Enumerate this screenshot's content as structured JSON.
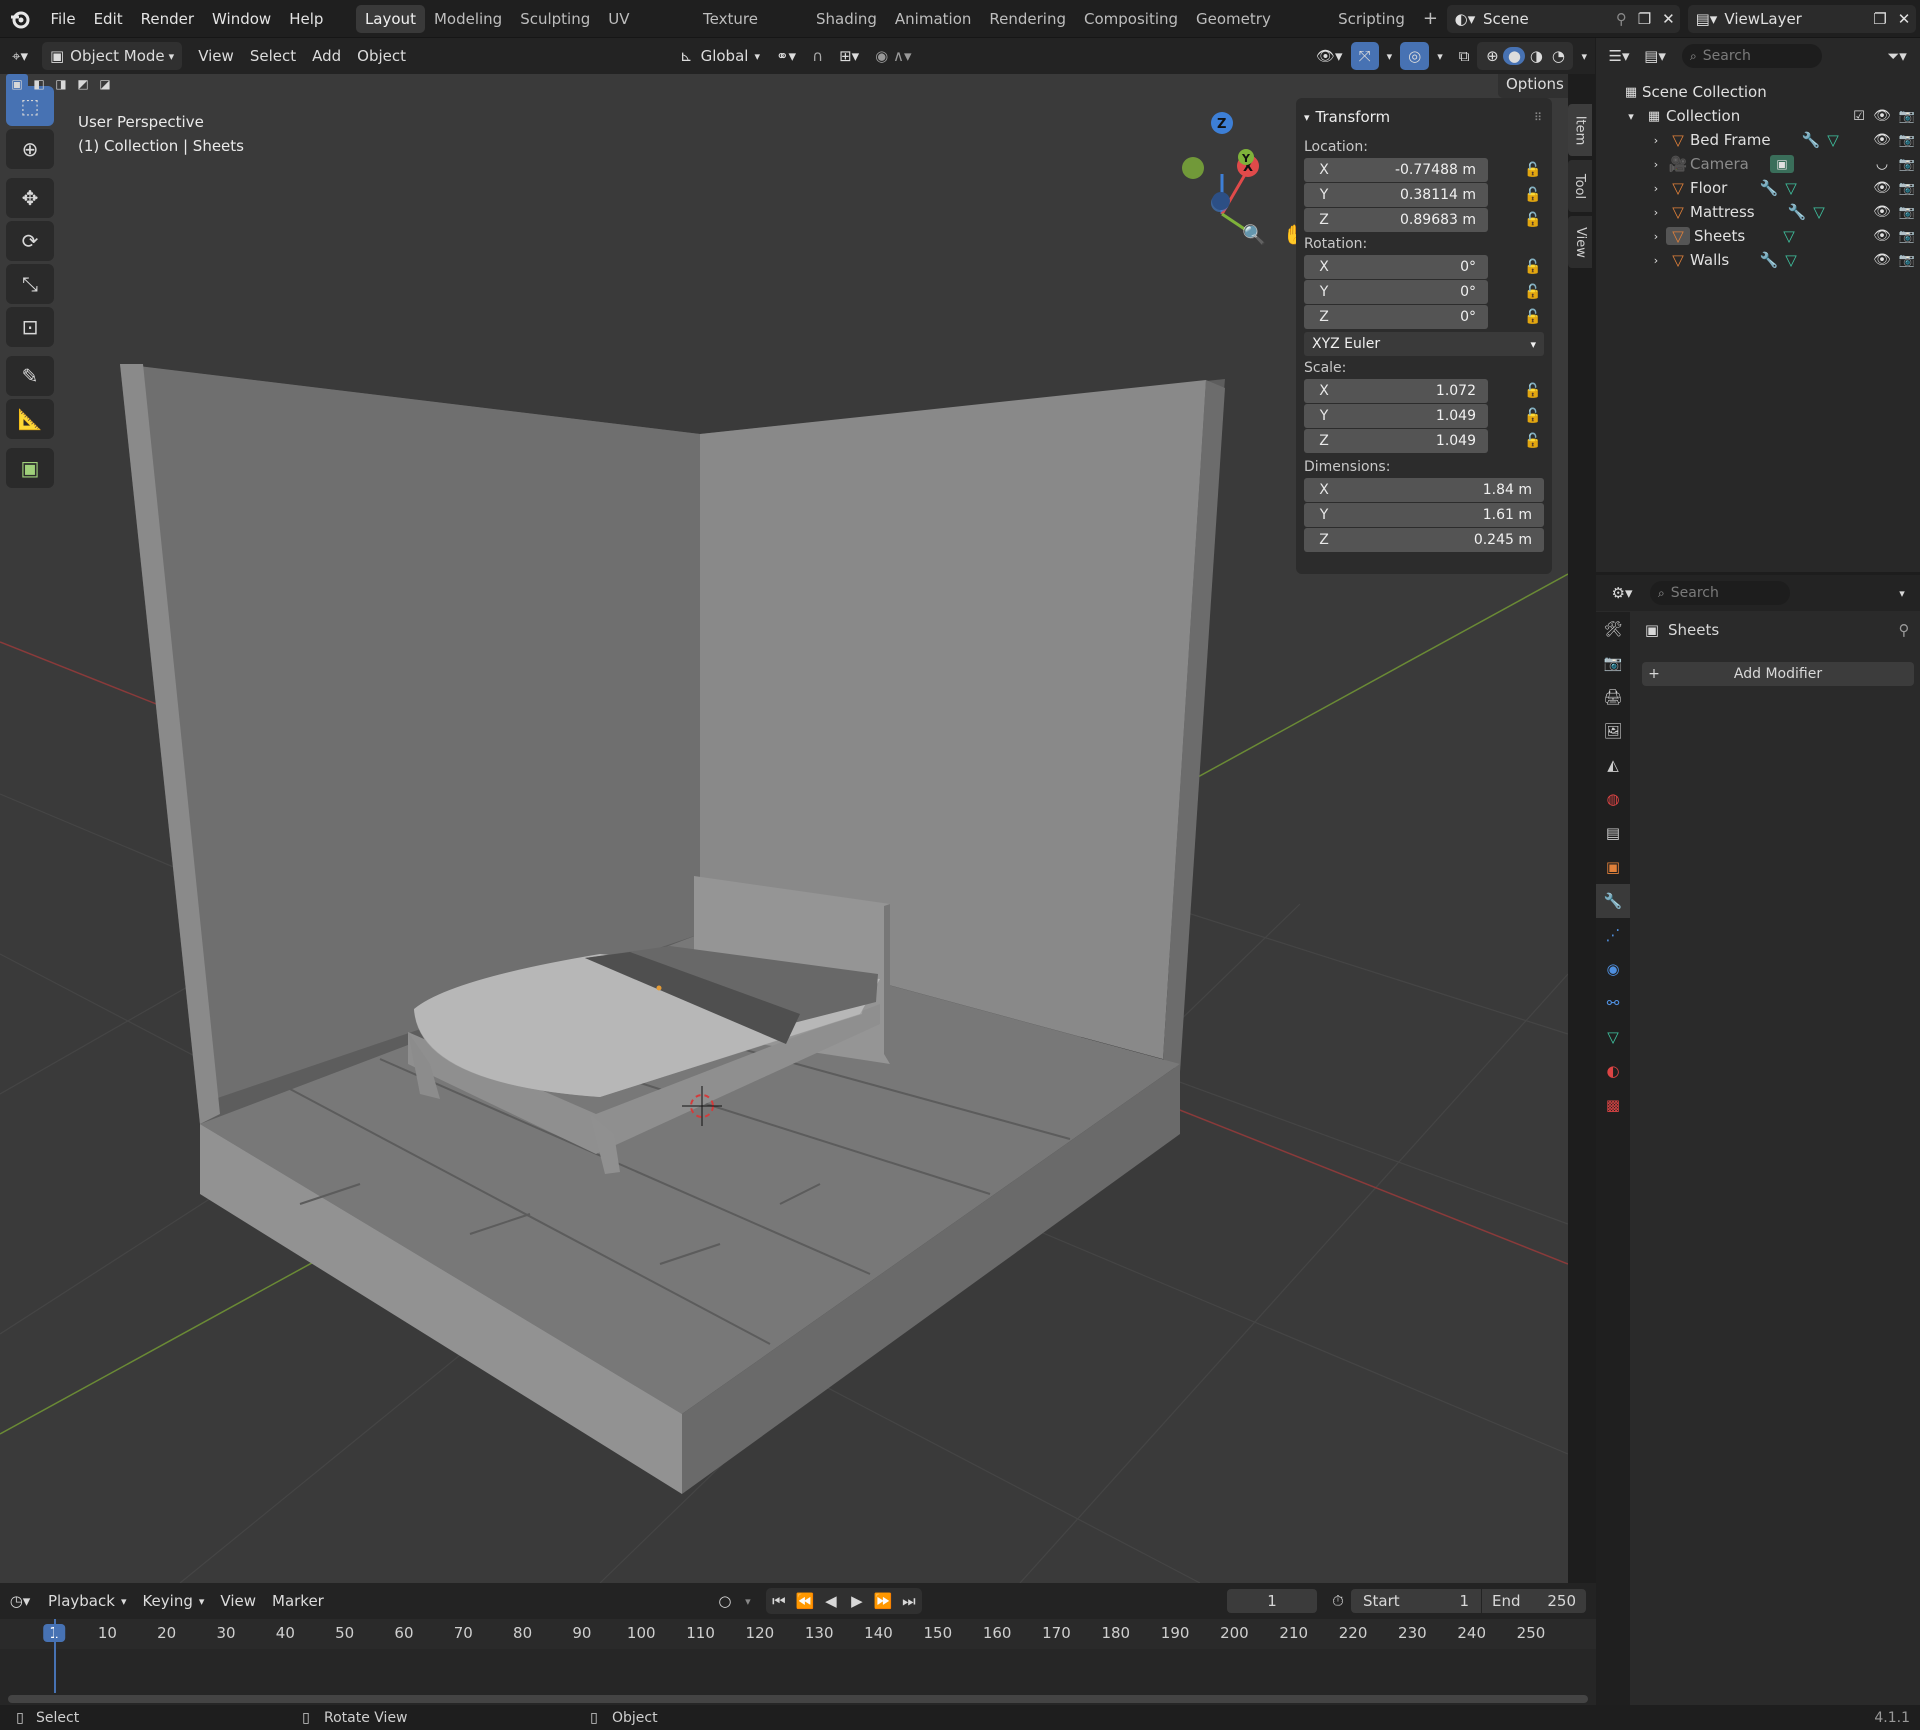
{
  "menu": {
    "file": "File",
    "edit": "Edit",
    "render": "Render",
    "window": "Window",
    "help": "Help"
  },
  "workspaces": [
    "Layout",
    "Modeling",
    "Sculpting",
    "UV Editing",
    "Texture Paint",
    "Shading",
    "Animation",
    "Rendering",
    "Compositing",
    "Geometry Nodes",
    "Scripting"
  ],
  "scene": {
    "name": "Scene",
    "view_layer": "ViewLayer"
  },
  "viewport_header": {
    "mode": "Object Mode",
    "view": "View",
    "select": "Select",
    "add": "Add",
    "object": "Object",
    "orientation": "Global",
    "options": "Options"
  },
  "viewport": {
    "perspective": "User Perspective",
    "context": "(1) Collection | Sheets"
  },
  "npanel": {
    "section": "Transform",
    "location_label": "Location:",
    "location": [
      {
        "axis": "X",
        "value": "-0.77488 m"
      },
      {
        "axis": "Y",
        "value": "0.38114 m"
      },
      {
        "axis": "Z",
        "value": "0.89683 m"
      }
    ],
    "rotation_label": "Rotation:",
    "rotation": [
      {
        "axis": "X",
        "value": "0°"
      },
      {
        "axis": "Y",
        "value": "0°"
      },
      {
        "axis": "Z",
        "value": "0°"
      }
    ],
    "rotation_mode": "XYZ Euler",
    "scale_label": "Scale:",
    "scale": [
      {
        "axis": "X",
        "value": "1.072"
      },
      {
        "axis": "Y",
        "value": "1.049"
      },
      {
        "axis": "Z",
        "value": "1.049"
      }
    ],
    "dimensions_label": "Dimensions:",
    "dimensions": [
      {
        "axis": "X",
        "value": "1.84 m"
      },
      {
        "axis": "Y",
        "value": "1.61 m"
      },
      {
        "axis": "Z",
        "value": "0.245 m"
      }
    ],
    "tabs": [
      "Item",
      "Tool",
      "View"
    ]
  },
  "outliner": {
    "search_placeholder": "Search",
    "root": "Scene Collection",
    "collection": "Collection",
    "items": [
      {
        "name": "Bed Frame",
        "type": "mesh",
        "modifier": true
      },
      {
        "name": "Camera",
        "type": "camera",
        "modifier": false
      },
      {
        "name": "Floor",
        "type": "mesh",
        "modifier": true
      },
      {
        "name": "Mattress",
        "type": "mesh",
        "modifier": true
      },
      {
        "name": "Sheets",
        "type": "mesh",
        "modifier": false
      },
      {
        "name": "Walls",
        "type": "mesh",
        "modifier": true
      }
    ]
  },
  "properties": {
    "search_placeholder": "Search",
    "object_name": "Sheets",
    "add_modifier": "Add Modifier"
  },
  "timeline": {
    "playback": "Playback",
    "keying": "Keying",
    "view": "View",
    "marker": "Marker",
    "current_frame": "1",
    "start_label": "Start",
    "start": "1",
    "end_label": "End",
    "end": "250",
    "ticks": [
      "1",
      "10",
      "20",
      "30",
      "40",
      "50",
      "60",
      "70",
      "80",
      "90",
      "100",
      "110",
      "120",
      "130",
      "140",
      "150",
      "160",
      "170",
      "180",
      "190",
      "200",
      "210",
      "220",
      "230",
      "240",
      "250"
    ]
  },
  "status": {
    "select": "Select",
    "rotate": "Rotate View",
    "object": "Object",
    "version": "4.1.1"
  },
  "colors": {
    "accent": "#4772b3",
    "axis_x": "#e04a4a",
    "axis_y": "#7fb23a",
    "axis_z": "#3d7fd6",
    "mesh_icon": "#e0803a",
    "data_icon": "#3fc3a0",
    "modifier_icon": "#4f8fde"
  }
}
